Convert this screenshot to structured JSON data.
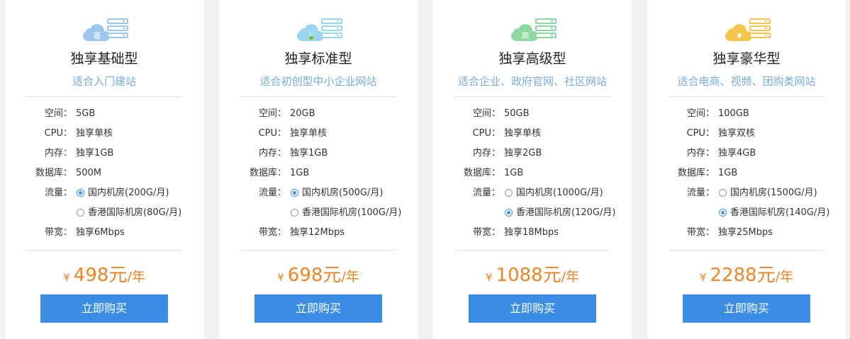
{
  "labels": {
    "space": "空间：",
    "cpu": "CPU：",
    "mem": "内存：",
    "db": "数据库：",
    "traffic": "流量：",
    "bandwidth": "带宽："
  },
  "plans": [
    {
      "badge": "基",
      "icon_color": "#9ac6ef",
      "title": "独享基础型",
      "subtitle": "适合入门建站",
      "space": "5GB",
      "cpu": "独享单核",
      "mem": "独享1GB",
      "db": "500M",
      "traffic_options": [
        {
          "label": "国内机房(200G/月)",
          "selected": true
        },
        {
          "label": "香港国际机房(80G/月)",
          "selected": false
        }
      ],
      "bandwidth": "独享6Mbps",
      "currency": "¥",
      "price": "498元",
      "period": "/年",
      "buy": "立即购买"
    },
    {
      "badge": "🍃",
      "icon_color": "#9ad6f1",
      "title": "独享标准型",
      "subtitle": "适合初创型中小企业网站",
      "space": "20GB",
      "cpu": "独享单核",
      "mem": "独享1GB",
      "db": "1GB",
      "traffic_options": [
        {
          "label": "国内机房(500G/月)",
          "selected": true
        },
        {
          "label": "香港国际机房(100G/月)",
          "selected": false
        }
      ],
      "bandwidth": "独享12Mbps",
      "currency": "¥",
      "price": "698元",
      "period": "/年",
      "buy": "立即购买"
    },
    {
      "badge": "高",
      "icon_color": "#8cd7a2",
      "title": "独享高级型",
      "subtitle": "适合企业、政府官网、社区网站",
      "space": "50GB",
      "cpu": "独享单核",
      "mem": "独享2GB",
      "db": "1GB",
      "traffic_options": [
        {
          "label": "国内机房(1000G/月)",
          "selected": false
        },
        {
          "label": "香港国际机房(120G/月)",
          "selected": true
        }
      ],
      "bandwidth": "独享18Mbps",
      "currency": "¥",
      "price": "1088元",
      "period": "/年",
      "buy": "立即购买"
    },
    {
      "badge": "♦",
      "icon_color": "#f6c64c",
      "title": "独享豪华型",
      "subtitle": "适合电商、视频、团购类网站",
      "space": "100GB",
      "cpu": "独享双核",
      "mem": "独享4GB",
      "db": "1GB",
      "traffic_options": [
        {
          "label": "国内机房(1500G/月)",
          "selected": false
        },
        {
          "label": "香港国际机房(140G/月)",
          "selected": true
        }
      ],
      "bandwidth": "独享25Mbps",
      "currency": "¥",
      "price": "2288元",
      "period": "/年",
      "buy": "立即购买"
    }
  ]
}
